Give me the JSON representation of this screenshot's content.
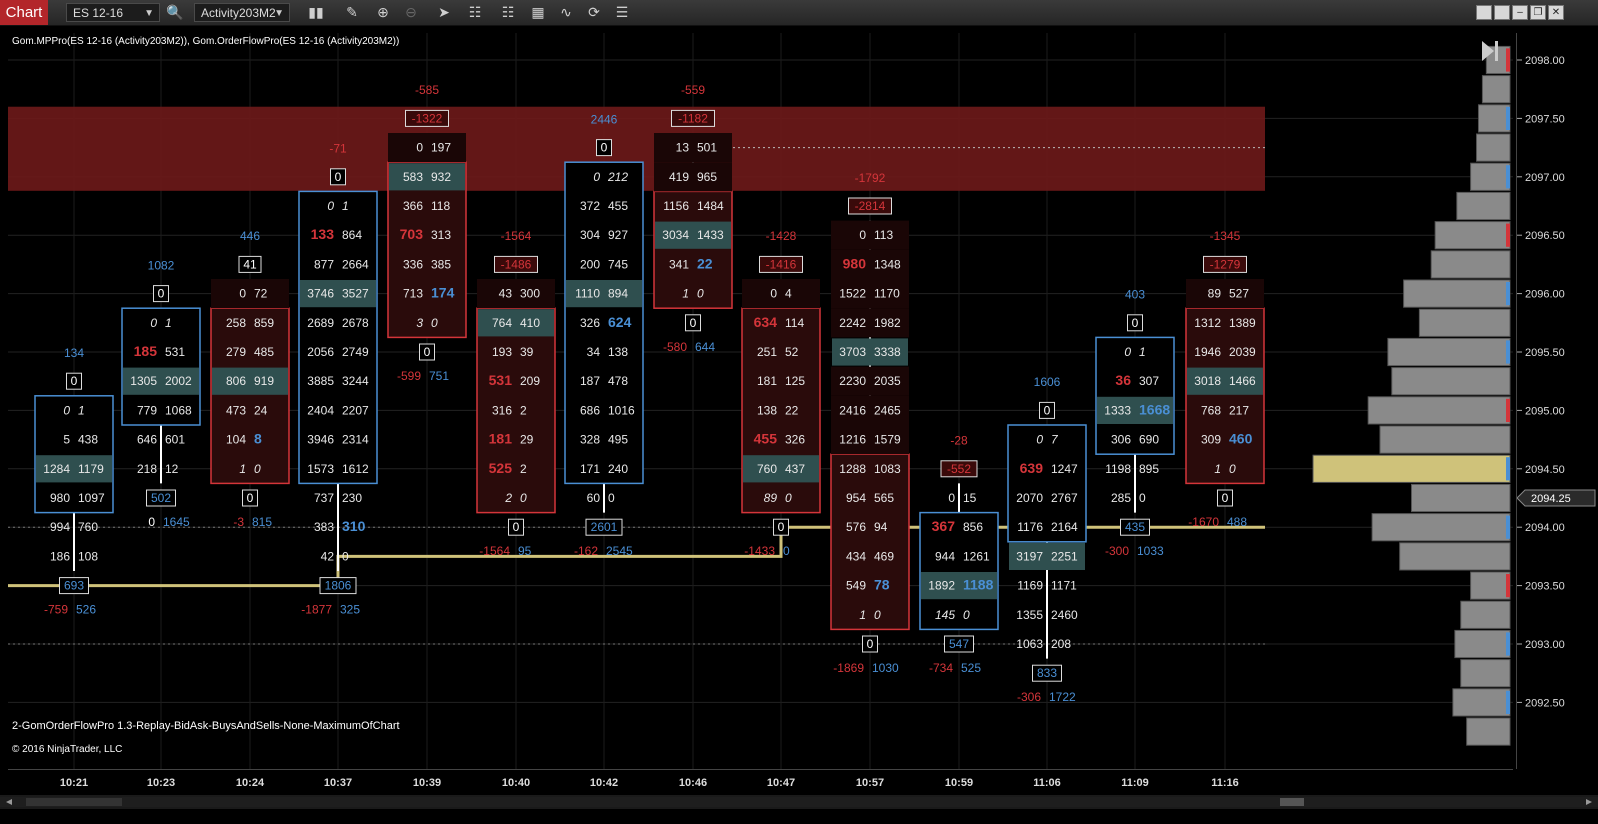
{
  "toolbar": {
    "tab": "Chart",
    "instrument": "ES 12-16",
    "template": "Activity203M2",
    "icons": [
      "search-icon",
      "bars-icon",
      "pencil-icon",
      "zoom-in-icon",
      "zoom-out-icon",
      "pointer-icon",
      "properties-icon",
      "strategies-icon",
      "databox-icon",
      "indicators-icon",
      "refresh-icon",
      "list-icon"
    ]
  },
  "chart": {
    "indicator_header": "Gom.MPPro(ES 12-16 (Activity203M2)), Gom.OrderFlowPro(ES 12-16 (Activity203M2))",
    "footer_label": "2-GomOrderFlowPro 1.3-Replay-BidAsk-BuysAndSells-None-MaximumOfChart",
    "copyright": "© 2016 NinjaTrader, LLC",
    "current_price": "2094.25",
    "price_labels": [
      "2098.00",
      "2097.50",
      "2097.00",
      "2096.50",
      "2096.00",
      "2095.50",
      "2095.00",
      "2094.50",
      "2094.00",
      "2093.50",
      "2093.00",
      "2092.50"
    ],
    "time_labels": [
      "10:21",
      "10:23",
      "10:24",
      "10:37",
      "10:39",
      "10:40",
      "10:42",
      "10:46",
      "10:47",
      "10:57",
      "10:59",
      "11:06",
      "11:09",
      "11:16"
    ],
    "colors": {
      "up": "#4a8fd4",
      "down": "#d4353a",
      "poc": "#2f4f4f",
      "zone": "#6e1a1a",
      "poc_line": "#cfc27a",
      "text": "#e8e8e8"
    }
  },
  "chart_data": {
    "type": "table",
    "title": "",
    "price_levels": [
      2098.0,
      2097.75,
      2097.5,
      2097.25,
      2097.0,
      2096.75,
      2096.5,
      2096.25,
      2096.0,
      2095.75,
      2095.5,
      2095.25,
      2095.0,
      2094.75,
      2094.5,
      2094.25,
      2094.0,
      2093.75,
      2093.5,
      2093.25,
      2093.0,
      2092.75,
      2092.5
    ],
    "bars": [
      {
        "time": "10:21",
        "dir": "up",
        "total": "134",
        "top_delta": "0",
        "rows": [
          [
            "0",
            "1"
          ],
          [
            "5",
            "438"
          ],
          [
            "1284",
            "1179"
          ],
          [
            "980",
            "1097"
          ],
          [
            "994",
            "760"
          ],
          [
            "186",
            "108"
          ]
        ],
        "body": [
          0,
          3
        ],
        "poc": 2,
        "box": "693",
        "bot": [
          "-759",
          "526"
        ],
        "hi": []
      },
      {
        "time": "10:23",
        "dir": "up",
        "total": "1082",
        "top_delta": "0",
        "rows": [
          [
            "0",
            "1"
          ],
          [
            "185",
            "531"
          ],
          [
            "1305",
            "2002"
          ],
          [
            "779",
            "1068"
          ],
          [
            "646",
            "601"
          ],
          [
            "218",
            "12"
          ]
        ],
        "body": [
          0,
          3
        ],
        "poc": 2,
        "box": "502",
        "bot": [
          "0",
          "1645"
        ],
        "hi": [
          [
            "1",
            "b"
          ]
        ]
      },
      {
        "time": "10:24",
        "dir": "down",
        "total": "446",
        "top_delta": "41",
        "rows": [
          [
            "0",
            "72"
          ],
          [
            "258",
            "859"
          ],
          [
            "279",
            "485"
          ],
          [
            "806",
            "919"
          ],
          [
            "473",
            "24"
          ],
          [
            "104",
            "8"
          ],
          [
            "1",
            "0"
          ]
        ],
        "body": [
          1,
          6
        ],
        "poc": 3,
        "box": "0",
        "bot": [
          "-3",
          "815"
        ],
        "hi": [
          [
            "5",
            "a"
          ]
        ]
      },
      {
        "time": "10:37",
        "dir": "up",
        "total": "-71",
        "top_delta": "0",
        "rows": [
          [
            "0",
            "1"
          ],
          [
            "133",
            "864"
          ],
          [
            "877",
            "2664"
          ],
          [
            "3746",
            "3527"
          ],
          [
            "2689",
            "2678"
          ],
          [
            "2056",
            "2749"
          ],
          [
            "3885",
            "3244"
          ],
          [
            "2404",
            "2207"
          ],
          [
            "3946",
            "2314"
          ],
          [
            "1573",
            "1612"
          ],
          [
            "737",
            "230"
          ],
          [
            "383",
            "310"
          ],
          [
            "42",
            "0"
          ]
        ],
        "body": [
          0,
          9
        ],
        "poc": 3,
        "box": "1806",
        "bot": [
          "-1877",
          "325"
        ],
        "hi": [
          [
            "1",
            "b"
          ],
          [
            "11",
            "a"
          ]
        ]
      },
      {
        "time": "10:39",
        "dir": "down",
        "total": "-585",
        "top_delta": "-1322",
        "rows": [
          [
            "0",
            "197"
          ],
          [
            "583",
            "932"
          ],
          [
            "366",
            "118"
          ],
          [
            "703",
            "313"
          ],
          [
            "336",
            "385"
          ],
          [
            "713",
            "174"
          ],
          [
            "3",
            "0"
          ]
        ],
        "body": [
          1,
          6
        ],
        "poc": 1,
        "box": "0",
        "bot": [
          "-599",
          "751"
        ],
        "hi": [
          [
            "3",
            "b"
          ],
          [
            "5",
            "a"
          ]
        ]
      },
      {
        "time": "10:40",
        "dir": "down",
        "total": "-1564",
        "top_delta": "-1486",
        "rows": [
          [
            "43",
            "300"
          ],
          [
            "764",
            "410"
          ],
          [
            "193",
            "39"
          ],
          [
            "531",
            "209"
          ],
          [
            "316",
            "2"
          ],
          [
            "181",
            "29"
          ],
          [
            "525",
            "2"
          ],
          [
            "2",
            "0"
          ]
        ],
        "body": [
          1,
          7
        ],
        "poc": 1,
        "box": "0",
        "bot": [
          "-1564",
          "95"
        ],
        "hi": [
          [
            "3",
            "b"
          ],
          [
            "5",
            "b"
          ],
          [
            "6",
            "b"
          ]
        ]
      },
      {
        "time": "10:42",
        "dir": "up",
        "total": "2446",
        "top_delta": "0",
        "rows": [
          [
            "0",
            "212"
          ],
          [
            "372",
            "455"
          ],
          [
            "304",
            "927"
          ],
          [
            "200",
            "745"
          ],
          [
            "1110",
            "894"
          ],
          [
            "326",
            "624"
          ],
          [
            "34",
            "138"
          ],
          [
            "187",
            "478"
          ],
          [
            "686",
            "1016"
          ],
          [
            "328",
            "495"
          ],
          [
            "171",
            "240"
          ],
          [
            "60",
            "0"
          ]
        ],
        "body": [
          0,
          10
        ],
        "poc": 4,
        "box": "2601",
        "bot": [
          "-162",
          "2545"
        ],
        "hi": [
          [
            "5",
            "a"
          ]
        ]
      },
      {
        "time": "10:46",
        "dir": "down",
        "total": "-559",
        "top_delta": "-1182",
        "rows": [
          [
            "13",
            "501"
          ],
          [
            "419",
            "965"
          ],
          [
            "1156",
            "1484"
          ],
          [
            "3034",
            "1433"
          ],
          [
            "341",
            "22"
          ],
          [
            "1",
            "0"
          ]
        ],
        "body": [
          2,
          5
        ],
        "poc": 3,
        "box": "0",
        "bot": [
          "-580",
          "644"
        ],
        "hi": [
          [
            "4",
            "a"
          ]
        ]
      },
      {
        "time": "10:47",
        "dir": "down",
        "total": "-1428",
        "top_delta": "-1416",
        "rows": [
          [
            "0",
            "4"
          ],
          [
            "634",
            "114"
          ],
          [
            "251",
            "52"
          ],
          [
            "181",
            "125"
          ],
          [
            "138",
            "22"
          ],
          [
            "455",
            "326"
          ],
          [
            "760",
            "437"
          ],
          [
            "89",
            "0"
          ]
        ],
        "body": [
          1,
          7
        ],
        "poc": 6,
        "box": "0",
        "bot": [
          "-1433",
          "0"
        ],
        "hi": [
          [
            "1",
            "b"
          ],
          [
            "5",
            "b"
          ]
        ]
      },
      {
        "time": "10:57",
        "dir": "down",
        "total": "-1792",
        "top_delta": "-2814",
        "rows": [
          [
            "0",
            "113"
          ],
          [
            "980",
            "1348"
          ],
          [
            "1522",
            "1170"
          ],
          [
            "2242",
            "1982"
          ],
          [
            "3703",
            "3338"
          ],
          [
            "2230",
            "2035"
          ],
          [
            "2416",
            "2465"
          ],
          [
            "1216",
            "1579"
          ],
          [
            "1288",
            "1083"
          ],
          [
            "954",
            "565"
          ],
          [
            "576",
            "94"
          ],
          [
            "434",
            "469"
          ],
          [
            "549",
            "78"
          ],
          [
            "1",
            "0"
          ]
        ],
        "body": [
          8,
          13
        ],
        "poc": 4,
        "box": "0",
        "bot": [
          "-1869",
          "1030"
        ],
        "hi": [
          [
            "1",
            "b"
          ],
          [
            "12",
            "a"
          ]
        ]
      },
      {
        "time": "10:59",
        "dir": "up",
        "total": "-28",
        "top_delta": "-552",
        "rows": [
          [
            "0",
            "15"
          ],
          [
            "367",
            "856"
          ],
          [
            "944",
            "1261"
          ],
          [
            "1892",
            "1188"
          ],
          [
            "145",
            "0"
          ]
        ],
        "body": [
          1,
          4
        ],
        "poc": 3,
        "box": "547",
        "bot": [
          "-734",
          "525"
        ],
        "hi": [
          [
            "1",
            "b"
          ],
          [
            "3",
            "a"
          ]
        ]
      },
      {
        "time": "11:06",
        "dir": "up",
        "total": "1606",
        "top_delta": "0",
        "rows": [
          [
            "0",
            "7"
          ],
          [
            "639",
            "1247"
          ],
          [
            "2070",
            "2767"
          ],
          [
            "1176",
            "2164"
          ],
          [
            "3197",
            "2251"
          ],
          [
            "1169",
            "1171"
          ],
          [
            "1355",
            "2460"
          ],
          [
            "1063",
            "208"
          ]
        ],
        "body": [
          0,
          3
        ],
        "poc": 4,
        "box": "833",
        "bot": [
          "-306",
          "1722"
        ],
        "hi": [
          [
            "1",
            "b"
          ]
        ]
      },
      {
        "time": "11:09",
        "dir": "up",
        "total": "403",
        "top_delta": "0",
        "rows": [
          [
            "0",
            "1"
          ],
          [
            "36",
            "307"
          ],
          [
            "1333",
            "1668"
          ],
          [
            "306",
            "690"
          ],
          [
            "1198",
            "895"
          ],
          [
            "285",
            "0"
          ]
        ],
        "body": [
          0,
          3
        ],
        "poc": 2,
        "box": "435",
        "bot": [
          "-300",
          "1033"
        ],
        "hi": [
          [
            "1",
            "b"
          ],
          [
            "2",
            "a"
          ]
        ]
      },
      {
        "time": "11:16",
        "dir": "down",
        "total": "-1345",
        "top_delta": "-1279",
        "rows": [
          [
            "89",
            "527"
          ],
          [
            "1312",
            "1389"
          ],
          [
            "1946",
            "2039"
          ],
          [
            "3018",
            "1466"
          ],
          [
            "768",
            "217"
          ],
          [
            "309",
            "460"
          ],
          [
            "1",
            "0"
          ]
        ],
        "body": [
          1,
          6
        ],
        "poc": 3,
        "box": "0",
        "bot": [
          "-1670",
          "488"
        ],
        "hi": [
          [
            "5",
            "a"
          ]
        ]
      }
    ],
    "profile_volumes": [
      12,
      14,
      16,
      17,
      20,
      27,
      38,
      40,
      54,
      46,
      62,
      60,
      72,
      66,
      100,
      50,
      70,
      56,
      20,
      25,
      28,
      25,
      29,
      22
    ]
  }
}
